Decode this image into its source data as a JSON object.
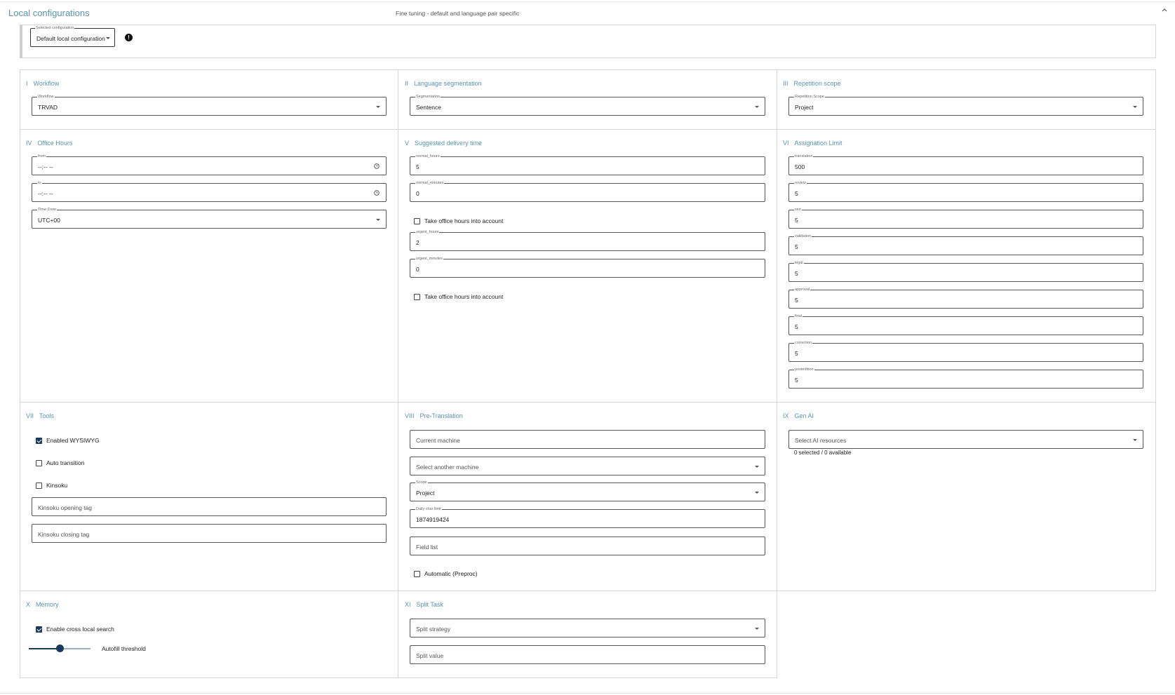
{
  "header": {
    "title": "Local configurations",
    "subtitle": "Fine tuning - default and language pair specific"
  },
  "selected_configuration": {
    "label": "Selected configuration",
    "value": "Default local configuration",
    "info": "!"
  },
  "sections": {
    "workflow": {
      "num": "I",
      "title": "Workflow",
      "field_label": "Workflow",
      "value": "TRVAD"
    },
    "segmentation": {
      "num": "II",
      "title": "Language segmentation",
      "field_label": "Segmentation",
      "value": "Sentence"
    },
    "repetition": {
      "num": "III",
      "title": "Repetition scope",
      "field_label": "Repetition Scope",
      "value": "Project"
    },
    "office_hours": {
      "num": "IV",
      "title": "Office Hours",
      "from_label": "from",
      "from_value": "--:-- --",
      "to_label": "to",
      "to_value": "--:-- --",
      "tz_label": "Time Zone",
      "tz_value": "UTC+00"
    },
    "delivery": {
      "num": "V",
      "title": "Suggested delivery time",
      "normal_hours_label": "normal_hours",
      "normal_hours": "5",
      "normal_minutes_label": "normal_minutes",
      "normal_minutes": "0",
      "office_hours_check_1": "Take office hours into account",
      "urgent_hours_label": "urgent_hours",
      "urgent_hours": "2",
      "urgent_minutes_label": "urgent_minutes",
      "urgent_minutes": "0",
      "office_hours_check_2": "Take office hours into account"
    },
    "assignation": {
      "num": "VI",
      "title": "Assignation Limit",
      "fields": [
        {
          "label": "translation",
          "value": "500"
        },
        {
          "label": "review",
          "value": "5"
        },
        {
          "label": "seo",
          "value": "5"
        },
        {
          "label": "validation",
          "value": "5"
        },
        {
          "label": "legal",
          "value": "5"
        },
        {
          "label": "approval",
          "value": "5"
        },
        {
          "label": "final",
          "value": "5"
        },
        {
          "label": "correction",
          "value": "5"
        },
        {
          "label": "postedition",
          "value": "5"
        }
      ]
    },
    "tools": {
      "num": "VII",
      "title": "Tools",
      "wysiwyg": "Enabled WYSIWYG",
      "auto_transition": "Auto transition",
      "kinsoku": "Kinsoku",
      "kinsoku_open_ph": "Kinsoku opening tag",
      "kinsoku_close_ph": "Kinsoku closing tag"
    },
    "pretranslation": {
      "num": "VIII",
      "title": "Pre-Translation",
      "current_machine_ph": "Current machine",
      "another_machine_ph": "Select another machine",
      "scope_label": "Scope",
      "scope_value": "Project",
      "daily_label": "Daily char limit",
      "daily_value": "1874919424",
      "field_list_ph": "Field list",
      "automatic": "Automatic (Preproc)"
    },
    "genai": {
      "num": "IX",
      "title": "Gen AI",
      "resources_ph": "Select AI resources",
      "helper": "0 selected / 0 available"
    },
    "memory": {
      "num": "X",
      "title": "Memory",
      "cross_search": "Enable cross local search",
      "autofill_label": "Autofill threshold",
      "autofill_value": 0.5
    },
    "split": {
      "num": "XI",
      "title": "Split Task",
      "strategy_ph": "Split strategy",
      "value_ph": "Split value"
    }
  },
  "colors": {
    "accent": "#5a93b3",
    "checkbox": "#1a3a5c",
    "border": "#d6d6d6"
  }
}
